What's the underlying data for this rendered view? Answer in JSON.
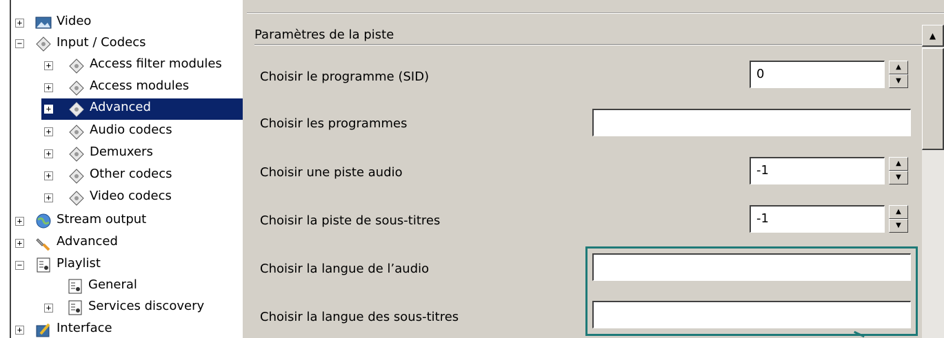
{
  "tree": {
    "items": [
      {
        "label": "Video",
        "expander": "+",
        "icon": "video-icon",
        "level": 0
      },
      {
        "label": "Input / Codecs",
        "expander": "−",
        "icon": "codec-disc-icon",
        "level": 0
      },
      {
        "label": "Access filter modules",
        "expander": "+",
        "icon": "codec-disc-icon",
        "level": 1
      },
      {
        "label": "Access modules",
        "expander": "+",
        "icon": "codec-disc-icon",
        "level": 1
      },
      {
        "label": "Advanced",
        "expander": "+",
        "icon": "codec-disc-icon",
        "level": 1,
        "selected": true
      },
      {
        "label": "Audio codecs",
        "expander": "+",
        "icon": "codec-disc-icon",
        "level": 1
      },
      {
        "label": "Demuxers",
        "expander": "+",
        "icon": "codec-disc-icon",
        "level": 1
      },
      {
        "label": "Other codecs",
        "expander": "+",
        "icon": "codec-disc-icon",
        "level": 1
      },
      {
        "label": "Video codecs",
        "expander": "+",
        "icon": "codec-disc-icon",
        "level": 1
      },
      {
        "label": "Stream output",
        "expander": "+",
        "icon": "globe-icon",
        "level": 0
      },
      {
        "label": "Advanced",
        "expander": "+",
        "icon": "wrench-icon",
        "level": 0
      },
      {
        "label": "Playlist",
        "expander": "−",
        "icon": "playlist-icon",
        "level": 0
      },
      {
        "label": "General",
        "expander": "",
        "icon": "playlist-icon",
        "level": 1
      },
      {
        "label": "Services discovery",
        "expander": "+",
        "icon": "playlist-icon",
        "level": 1
      },
      {
        "label": "Interface",
        "expander": "+",
        "icon": "interface-icon",
        "level": 0
      }
    ]
  },
  "panel": {
    "section_title": "Paramètres de la piste",
    "rows": [
      {
        "label": "Choisir le programme (SID)",
        "type": "spin",
        "value": "0"
      },
      {
        "label": "Choisir les programmes",
        "type": "text",
        "value": ""
      },
      {
        "label": "Choisir une piste audio",
        "type": "spin",
        "value": "-1"
      },
      {
        "label": "Choisir la piste de sous-titres",
        "type": "spin",
        "value": "-1"
      },
      {
        "label": "Choisir la langue de l’audio",
        "type": "text",
        "value": ""
      },
      {
        "label": "Choisir la langue des sous-titres",
        "type": "text",
        "value": ""
      }
    ],
    "spin_up_glyph": "▲",
    "spin_down_glyph": "▼",
    "scroll_up_glyph": "▲"
  },
  "colors": {
    "selection": "#0a246a",
    "highlight_box": "#1e7a78",
    "panel_bg": "#d4d0c8"
  }
}
